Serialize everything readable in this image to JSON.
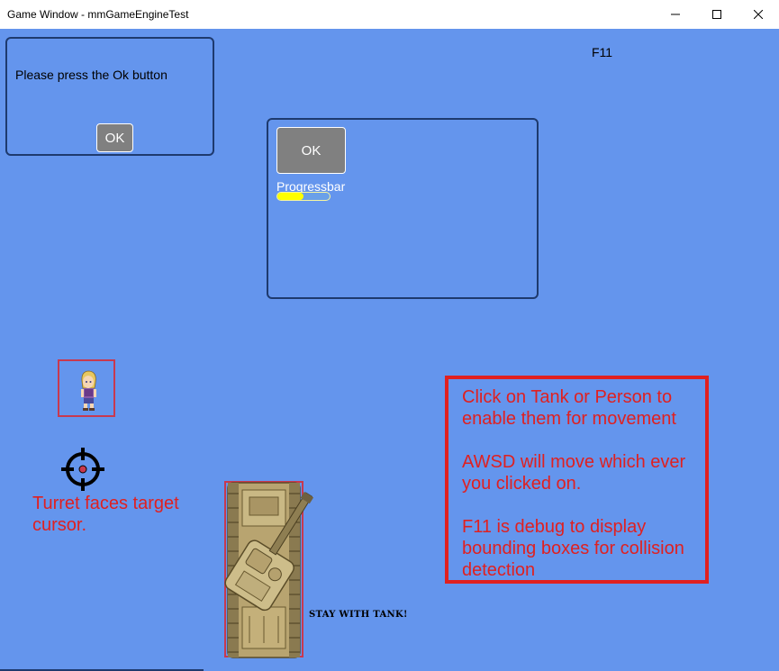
{
  "window": {
    "title": "Game Window - mmGameEngineTest",
    "minimize_glyph": "—",
    "maximize_glyph": "☐",
    "close_glyph": "✕"
  },
  "dialog1": {
    "message": "Please press the Ok button",
    "ok_label": "OK"
  },
  "dialog2": {
    "ok_label": "OK",
    "progress_label": "Progressbar",
    "progress_value": 0.5
  },
  "debug_key_label": "F11",
  "turret_hint": "Turret faces target cursor.",
  "tank_tag": "STAY WITH TANK!",
  "instructions": {
    "line1": "Click on Tank or Person to enable them for movement",
    "line2": "AWSD will move which ever you clicked on.",
    "line3": "F11 is debug to display bounding boxes for collision detection"
  },
  "colors": {
    "background": "#6495ed",
    "hint_text": "#e02020",
    "bounding_box": "#c8394f",
    "progress_fill": "#ffff00"
  },
  "icons": [
    "crosshair-icon",
    "person-sprite",
    "tank-sprite"
  ]
}
